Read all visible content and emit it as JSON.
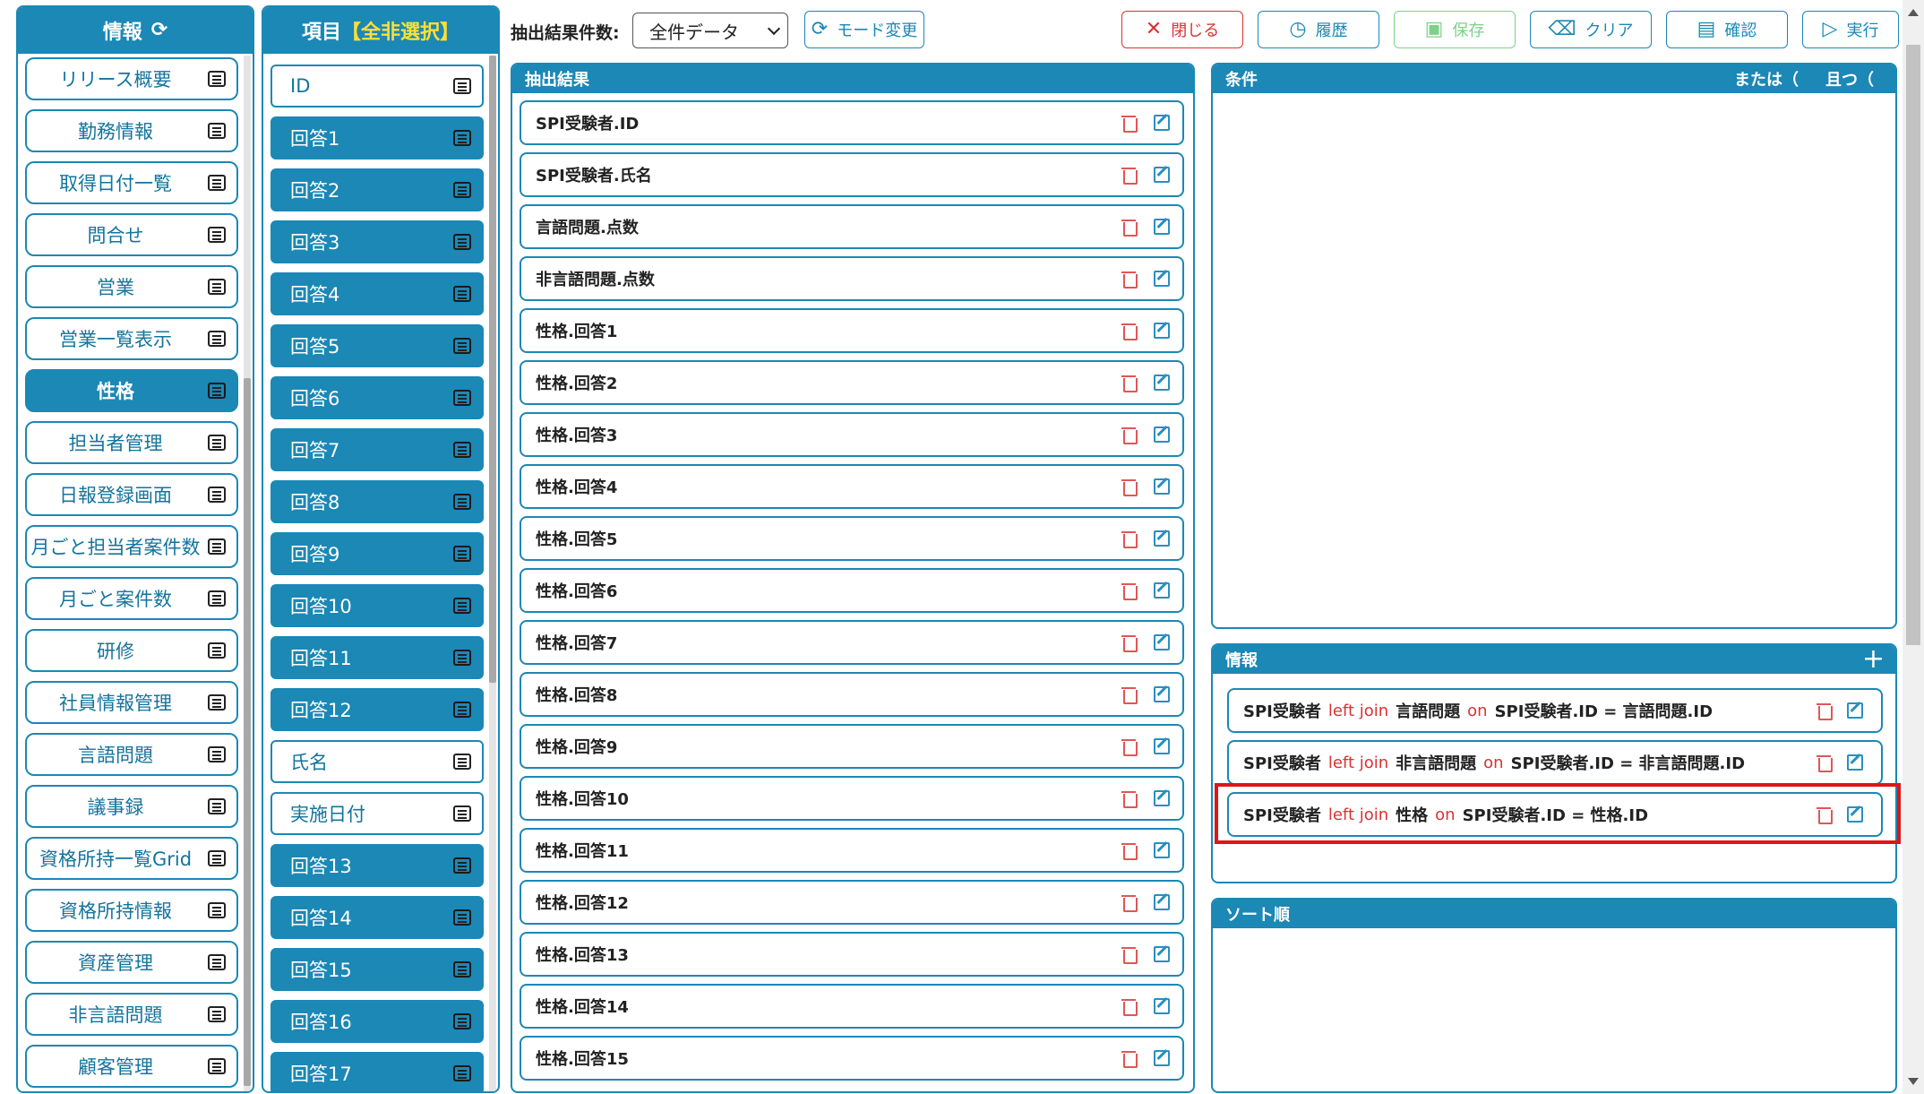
{
  "nav": {
    "title": "情報",
    "items": [
      {
        "label": "リリース概要",
        "active": false
      },
      {
        "label": "勤務情報",
        "active": false
      },
      {
        "label": "取得日付一覧",
        "active": false
      },
      {
        "label": "問合せ",
        "active": false
      },
      {
        "label": "営業",
        "active": false
      },
      {
        "label": "営業一覧表示",
        "active": false
      },
      {
        "label": "性格",
        "active": true
      },
      {
        "label": "担当者管理",
        "active": false
      },
      {
        "label": "日報登録画面",
        "active": false
      },
      {
        "label": "月ごと担当者案件数",
        "active": false
      },
      {
        "label": "月ごと案件数",
        "active": false
      },
      {
        "label": "研修",
        "active": false
      },
      {
        "label": "社員情報管理",
        "active": false
      },
      {
        "label": "言語問題",
        "active": false
      },
      {
        "label": "議事録",
        "active": false
      },
      {
        "label": "資格所持一覧Grid",
        "active": false
      },
      {
        "label": "資格所持情報",
        "active": false
      },
      {
        "label": "資産管理",
        "active": false
      },
      {
        "label": "非言語問題",
        "active": false
      },
      {
        "label": "顧客管理",
        "active": false
      }
    ]
  },
  "fields": {
    "title": "項目",
    "select_all": "【全非選択】",
    "items": [
      {
        "label": "ID",
        "selected": false
      },
      {
        "label": "回答1",
        "selected": true
      },
      {
        "label": "回答2",
        "selected": true
      },
      {
        "label": "回答3",
        "selected": true
      },
      {
        "label": "回答4",
        "selected": true
      },
      {
        "label": "回答5",
        "selected": true
      },
      {
        "label": "回答6",
        "selected": true
      },
      {
        "label": "回答7",
        "selected": true
      },
      {
        "label": "回答8",
        "selected": true
      },
      {
        "label": "回答9",
        "selected": true
      },
      {
        "label": "回答10",
        "selected": true
      },
      {
        "label": "回答11",
        "selected": true
      },
      {
        "label": "回答12",
        "selected": true
      },
      {
        "label": "氏名",
        "selected": false
      },
      {
        "label": "実施日付",
        "selected": false
      },
      {
        "label": "回答13",
        "selected": true
      },
      {
        "label": "回答14",
        "selected": true
      },
      {
        "label": "回答15",
        "selected": true
      },
      {
        "label": "回答16",
        "selected": true
      },
      {
        "label": "回答17",
        "selected": true
      }
    ]
  },
  "toolbar": {
    "count_label": "抽出結果件数:",
    "count_select": "全件データ",
    "mode_change": "モード変更",
    "close": "閉じる",
    "history": "履歴",
    "save": "保存",
    "clear": "クリア",
    "confirm": "確認",
    "run": "実行"
  },
  "result": {
    "title": "抽出結果",
    "rows": [
      "SPI受験者.ID",
      "SPI受験者.氏名",
      "言語問題.点数",
      "非言語問題.点数",
      "性格.回答1",
      "性格.回答2",
      "性格.回答3",
      "性格.回答4",
      "性格.回答5",
      "性格.回答6",
      "性格.回答7",
      "性格.回答8",
      "性格.回答9",
      "性格.回答10",
      "性格.回答11",
      "性格.回答12",
      "性格.回答13",
      "性格.回答14",
      "性格.回答15"
    ]
  },
  "conditions": {
    "title": "条件",
    "or_label": "または（",
    "and_label": "且つ（"
  },
  "info": {
    "title": "情報",
    "joins": [
      {
        "left": "SPI受験者",
        "join": "left join",
        "table": "言語問題",
        "on": "on",
        "cond": "SPI受験者.ID = 言語問題.ID"
      },
      {
        "left": "SPI受験者",
        "join": "left join",
        "table": "非言語問題",
        "on": "on",
        "cond": "SPI受験者.ID = 非言語問題.ID"
      },
      {
        "left": "SPI受験者",
        "join": "left join",
        "table": "性格",
        "on": "on",
        "cond": "SPI受験者.ID = 性格.ID"
      }
    ]
  },
  "sort": {
    "title": "ソート順"
  },
  "colors": {
    "accent": "#1b88b5",
    "danger": "#d93333",
    "save": "#7fd08a",
    "highlight": "#e01515",
    "select_all": "#ffe033"
  }
}
